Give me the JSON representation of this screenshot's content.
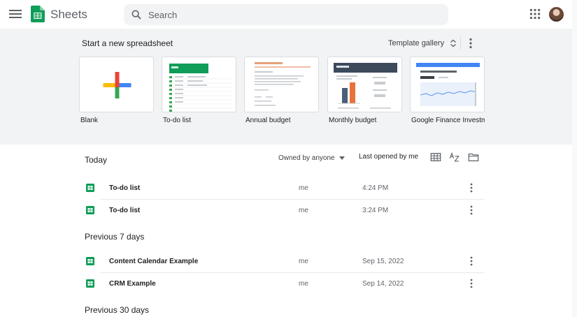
{
  "app": {
    "name": "Sheets"
  },
  "search": {
    "placeholder": "Search",
    "value": ""
  },
  "gallery": {
    "title": "Start a new spreadsheet",
    "template_gallery_label": "Template gallery",
    "templates": [
      {
        "label": "Blank"
      },
      {
        "label": "To-do list"
      },
      {
        "label": "Annual budget"
      },
      {
        "label": "Monthly budget"
      },
      {
        "label": "Google Finance Investment"
      }
    ]
  },
  "list": {
    "title": "Today",
    "owner_filter": "Owned by anyone",
    "sort_label": "Last opened by me",
    "sections": [
      {
        "label": "Today",
        "files": [
          {
            "name": "To-do list",
            "owner": "me",
            "date": "4:24 PM"
          },
          {
            "name": "To-do list",
            "owner": "me",
            "date": "3:24 PM"
          }
        ]
      },
      {
        "label": "Previous 7 days",
        "files": [
          {
            "name": "Content Calendar Example",
            "owner": "me",
            "date": "Sep 15, 2022"
          },
          {
            "name": "CRM Example",
            "owner": "me",
            "date": "Sep 14, 2022"
          }
        ]
      },
      {
        "label": "Previous 30 days",
        "files": []
      }
    ]
  },
  "colors": {
    "sheets_green": "#0f9d58",
    "gallery_bg": "#f1f3f4",
    "text": "#202124",
    "muted": "#5f6368"
  },
  "icons": [
    "menu-icon",
    "sheets-logo-icon",
    "search-icon",
    "apps-grid-icon",
    "unfold-icon",
    "more-vert-icon",
    "grid-view-icon",
    "sort-az-icon",
    "folder-icon",
    "sheets-file-icon"
  ]
}
